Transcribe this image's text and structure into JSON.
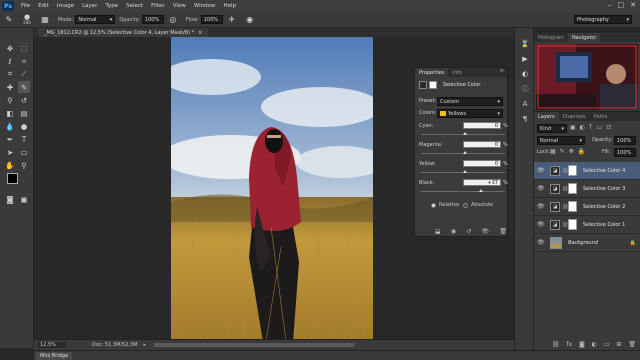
{
  "app": {
    "logo": "Ps",
    "menu": [
      "File",
      "Edit",
      "Image",
      "Layer",
      "Type",
      "Select",
      "Filter",
      "View",
      "Window",
      "Help"
    ],
    "window_controls": [
      "–",
      "□",
      "✕"
    ]
  },
  "options_bar": {
    "brush_size": "200",
    "mode_label": "Mode:",
    "mode_value": "Normal",
    "opacity_label": "Opacity:",
    "opacity_value": "100%",
    "flow_label": "Flow:",
    "flow_value": "100%",
    "workspace": "Photography"
  },
  "document": {
    "tab_title": "_MG_1812.CR2 @ 12,5% (Selective Color 4, Layer Mask/8) *",
    "close_glyph": "×",
    "zoom": "12,5%",
    "doc_size": "Doc: 51,3M/52,3M"
  },
  "mini_bridge": {
    "label": "Mini Bridge"
  },
  "properties": {
    "tabs": [
      "Properties",
      "Info"
    ],
    "title": "Selective Color",
    "preset_label": "Preset:",
    "preset_value": "Custom",
    "colors_label": "Colors:",
    "colors_value": "Yellows",
    "colors_swatch": "#e8c21a",
    "rows": [
      {
        "label": "Cyan:",
        "value": "0",
        "unit": "%"
      },
      {
        "label": "Magenta:",
        "value": "0",
        "unit": "%"
      },
      {
        "label": "Yellow:",
        "value": "0",
        "unit": "%"
      },
      {
        "label": "Black:",
        "value": "+37",
        "unit": "%"
      }
    ],
    "method_relative": "Relative",
    "method_absolute": "Absolute"
  },
  "navigator": {
    "tabs": [
      "Histogram",
      "Navigator"
    ]
  },
  "layers": {
    "tabs": [
      "Layers",
      "Channels",
      "Paths"
    ],
    "filter_kind": "Kind",
    "blend_mode": "Normal",
    "opacity_label": "Opacity:",
    "opacity_value": "100%",
    "lock_label": "Lock:",
    "fill_label": "Fill:",
    "fill_value": "100%",
    "items": [
      {
        "name": "Selective Color 4",
        "selected": true
      },
      {
        "name": "Selective Color 3",
        "selected": false
      },
      {
        "name": "Selective Color 2",
        "selected": false
      },
      {
        "name": "Selective Color 1",
        "selected": false
      },
      {
        "name": "Background",
        "selected": false
      }
    ],
    "footer_icons": [
      "link-icon",
      "fx-icon",
      "mask-icon",
      "adjustment-icon",
      "group-icon",
      "new-layer-icon",
      "trash-icon"
    ]
  },
  "colors": {
    "accent": "#4a5d78",
    "panel": "#3a3a3a",
    "bg": "#282828"
  }
}
